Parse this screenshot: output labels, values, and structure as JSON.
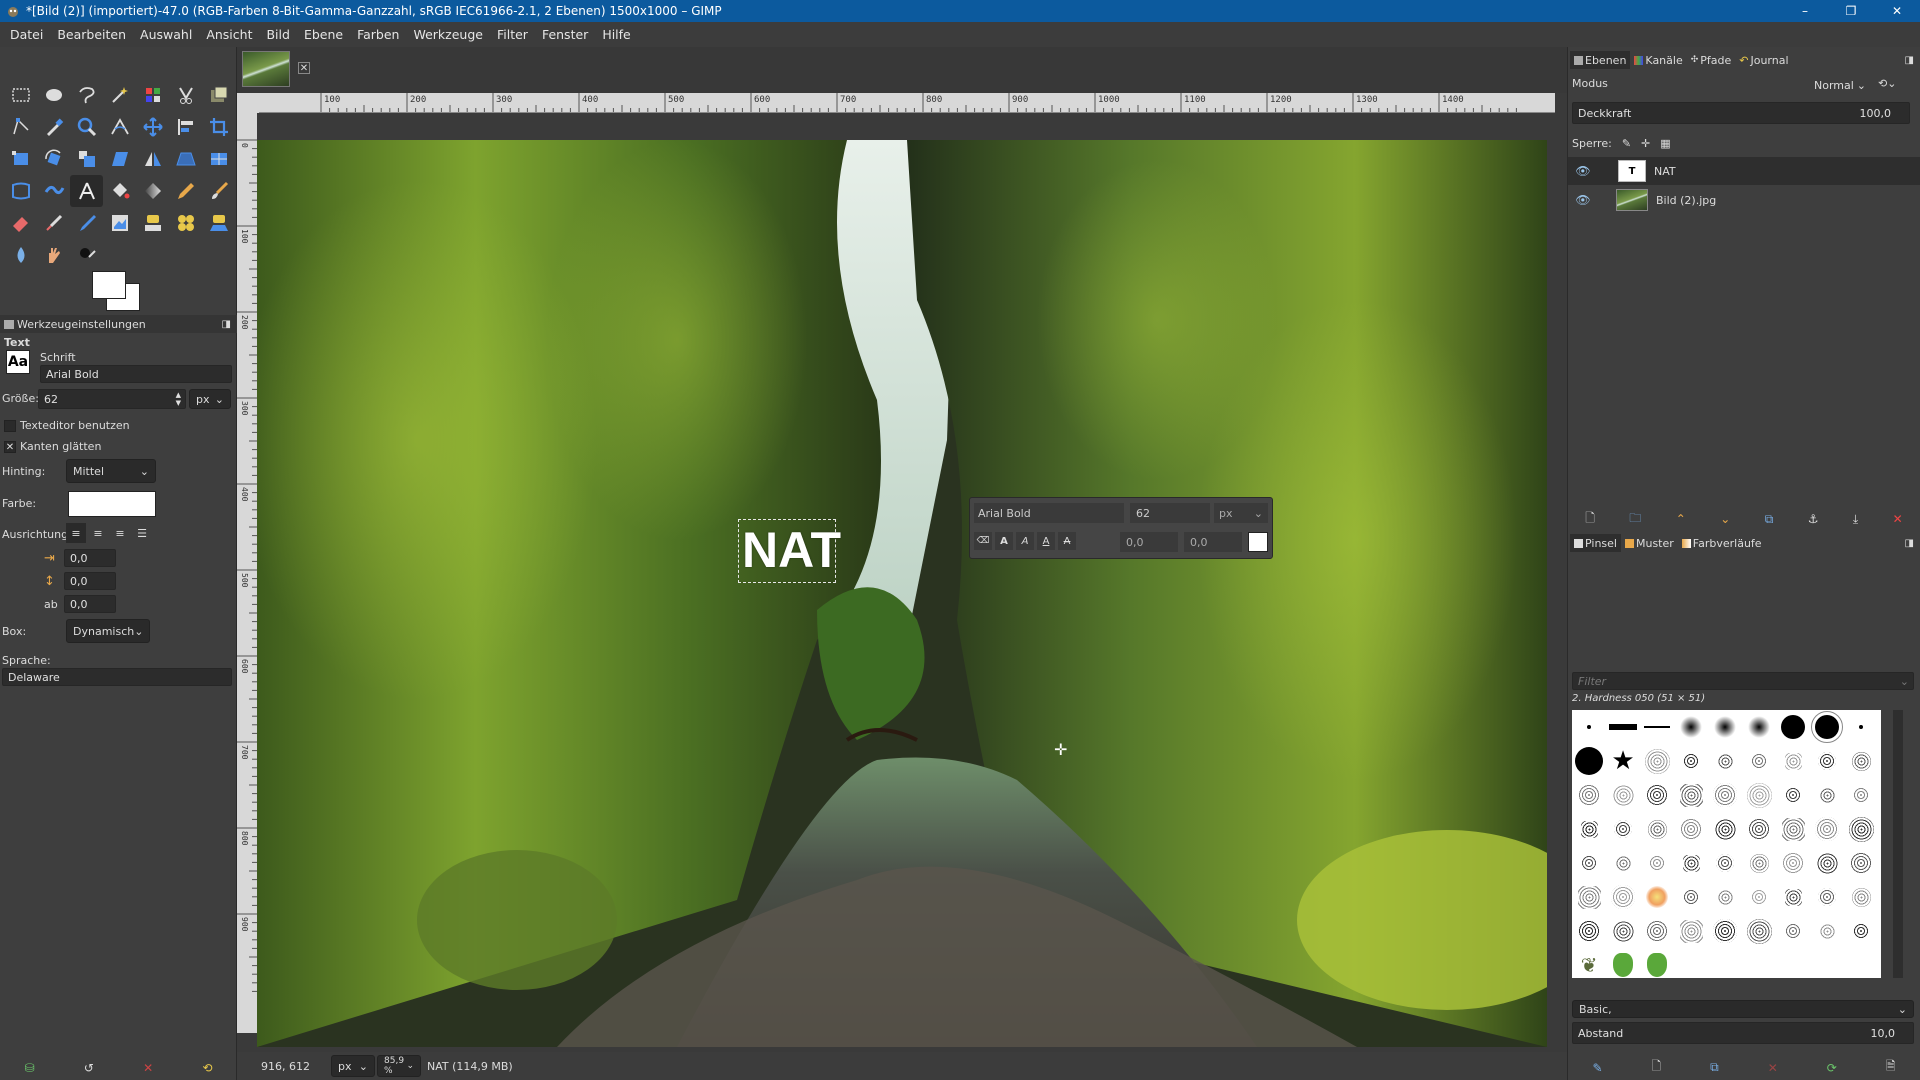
{
  "window": {
    "title": "*[Bild (2)] (importiert)-47.0 (RGB-Farben 8-Bit-Gamma-Ganzzahl, sRGB IEC61966-2.1, 2 Ebenen) 1500x1000 – GIMP",
    "minimize": "–",
    "maximize": "❐",
    "close": "✕"
  },
  "menu": [
    "Datei",
    "Bearbeiten",
    "Auswahl",
    "Ansicht",
    "Bild",
    "Ebene",
    "Farben",
    "Werkzeuge",
    "Filter",
    "Fenster",
    "Hilfe"
  ],
  "tool_options": {
    "tab_label": "Werkzeugeinstellungen",
    "tool_name": "Text",
    "font_label": "Schrift",
    "font_icon_text": "Aa",
    "font_value": "Arial Bold",
    "size_label": "Größe:",
    "size_value": "62",
    "size_unit": "px",
    "use_editor_label": "Texteditor benutzen",
    "antialias_label": "Kanten glätten",
    "hinting_label": "Hinting:",
    "hinting_value": "Mittel",
    "color_label": "Farbe:",
    "justify_label": "Ausrichtung:",
    "indent_value": "0,0",
    "line_spacing_value": "0,0",
    "letter_spacing_value": "0,0",
    "box_label": "Box:",
    "box_value": "Dynamisch",
    "language_label": "Sprache:",
    "language_value": "Delaware"
  },
  "ruler": {
    "h_labels": [
      "100",
      "200",
      "300",
      "400",
      "500",
      "600",
      "700",
      "800",
      "900",
      "1000",
      "1100",
      "1200",
      "1300",
      "1400"
    ],
    "v_labels": [
      "0",
      "100",
      "200",
      "300",
      "400",
      "500",
      "600",
      "700",
      "800",
      "900"
    ]
  },
  "canvas": {
    "text_layer_content": "NAT"
  },
  "text_toolbar": {
    "font": "Arial Bold",
    "size": "62",
    "unit": "px",
    "baseline": "0,0",
    "kerning": "0,0"
  },
  "status": {
    "coords": "916, 612",
    "unit": "px",
    "zoom": "85,9 %",
    "info": "NAT (114,9 MB)"
  },
  "layers_panel": {
    "tabs": [
      "Ebenen",
      "Kanäle",
      "Pfade",
      "Journal"
    ],
    "mode_label": "Modus",
    "mode_value": "Normal",
    "opacity_label": "Deckkraft",
    "opacity_value": "100,0",
    "lock_label": "Sperre:",
    "layers": [
      {
        "name": "NAT",
        "visible": true
      },
      {
        "name": "Bild (2).jpg",
        "visible": true
      }
    ]
  },
  "brushes_panel": {
    "tabs": [
      "Pinsel",
      "Muster",
      "Farbverläufe"
    ],
    "filter_placeholder": "Filter",
    "selected_brush": "2. Hardness 050 (51 × 51)",
    "preset": "Basic,",
    "spacing_label": "Abstand",
    "spacing_value": "10,0"
  },
  "colors": {
    "accent": "#0c5a9e",
    "foreground": "#ffffff",
    "background": "#ffffff"
  }
}
